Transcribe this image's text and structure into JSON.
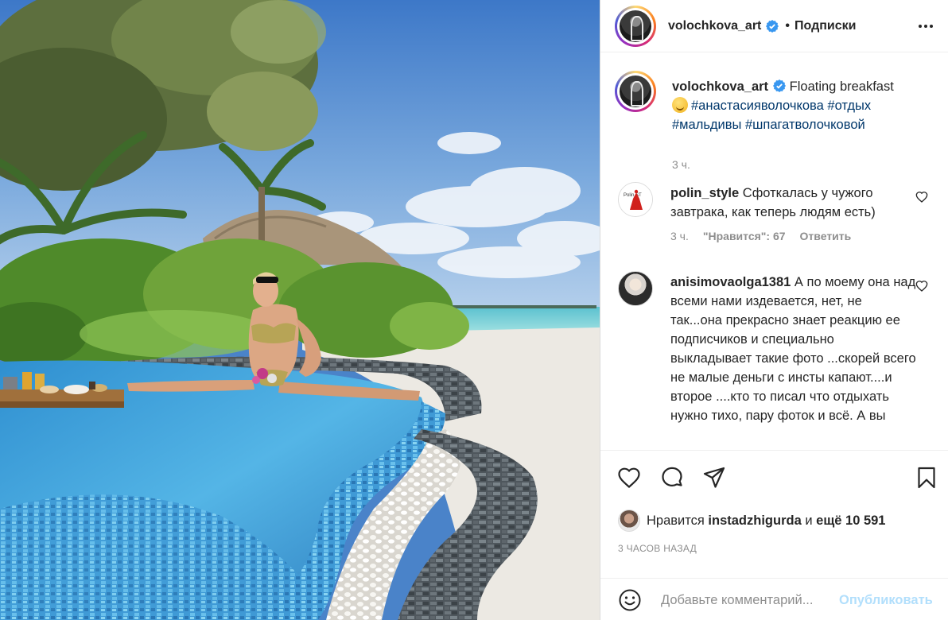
{
  "post": {
    "author": "volochkova_art",
    "follow_label": "Подписки",
    "separator": "•",
    "more_icon": "more-horizontal-icon"
  },
  "caption": {
    "author": "volochkova_art",
    "text": "Floating breakfast",
    "emoji": "smiling-face-emoji",
    "hashtags": [
      "#анастасияволочкова",
      "#отдых",
      "#мальдивы",
      "#шпагатволочковой"
    ],
    "time": "3 ч."
  },
  "comments": [
    {
      "author": "polin_style",
      "text": "Сфоткалась у чужого завтрака, как теперь людям есть)",
      "time": "3 ч.",
      "likes_label": "\"Нравится\": 67",
      "reply_label": "Ответить",
      "avatar_text": "Polin ST"
    },
    {
      "author": "anisimovaolga1381",
      "text": "А по моему она над всеми нами издевается, нет, не так...она прекрасно знает реакцию ее подписчиков и специально выкладывает такие фото ...скорей всего не малые деньги с инсты капают....и второе ....кто то писал что отдыхать нужно тихо, пару фоток и всё. А вы"
    }
  ],
  "likes": {
    "prefix": "Нравится",
    "user": "instadzhigurda",
    "conj": "и",
    "others": "ещё 10 591"
  },
  "timestamp": "3 ЧАСОВ НАЗАД",
  "comment_box": {
    "placeholder": "Добавьте комментарий...",
    "publish_label": "Опубликовать"
  },
  "colors": {
    "accent_blue": "#0095f6",
    "verified_blue": "#3897f0",
    "hashtag": "#00376b",
    "muted": "#8e8e8e"
  }
}
